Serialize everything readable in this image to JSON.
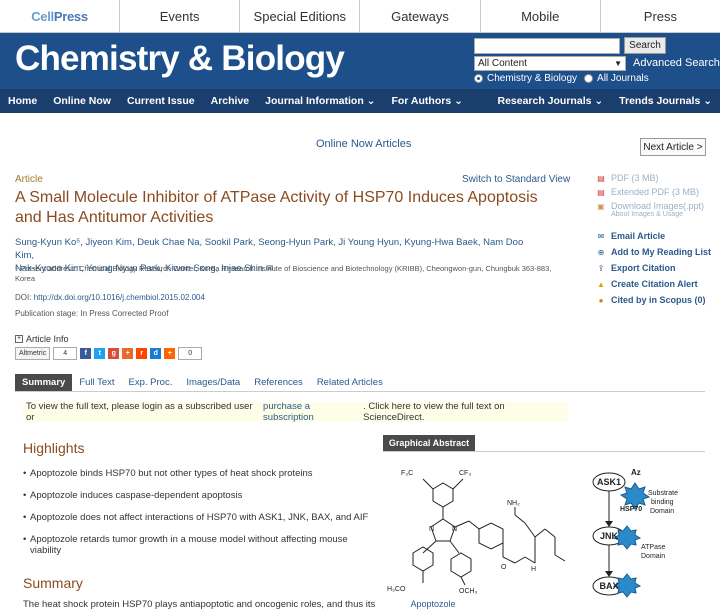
{
  "brand": {
    "logo_a": "Cell",
    "logo_b": "Press"
  },
  "topnav": [
    "Events",
    "Special Editions",
    "Gateways",
    "Mobile",
    "Press"
  ],
  "banner": {
    "title": "Chemistry & Biology",
    "search_button": "Search",
    "search_scope": "All Content",
    "advanced_search": "Advanced Search",
    "radio_journal": "Chemistry & Biology",
    "radio_all": "All Journals"
  },
  "mainnav": {
    "left": [
      "Home",
      "Online Now",
      "Current Issue",
      "Archive",
      "Journal Information ⌄",
      "For Authors ⌄"
    ],
    "right": [
      "Research Journals ⌄",
      "Trends Journals ⌄"
    ]
  },
  "page": {
    "online_now": "Online Now Articles",
    "next_article": "Next Article >",
    "article_label": "Article",
    "switch_view": "Switch to Standard View",
    "title": "A Small Molecule Inhibitor of ATPase Activity of HSP70 Induces Apoptosis and Has Antitumor Activities",
    "authors_1": "Sung-Kyun Ko⁵, Jiyeon Kim, Deuk Chae Na, Sookil Park, Seong-Hyun Park, Ji Young Hyun, Kyung-Hwa Baek, Nam Doo Kim,",
    "authors_2": "Nak-Kyoon Kim, Young Nyun Park, Kiwon Song, Injae Shin",
    "present_address": "⁵ Present address: Chemical Biology Research Center, Korea Research Institute of Bioscience and Biotechnology (KRIBB), Cheongwon-gun, Chungbuk 363-883, Korea",
    "doi_label": "DOI:",
    "doi": "http://dx.doi.org/10.1016/j.chembiol.2015.02.004",
    "pub_stage": "Publication stage: In Press Corrected Proof",
    "article_info": "Article Info",
    "altmetric": "Altmetric",
    "altmetric_count": "4",
    "share_count": "0"
  },
  "sidebar": {
    "pdf": "PDF (3 MB)",
    "ext_pdf": "Extended PDF (3 MB)",
    "download_images": "Download Images(.ppt)",
    "about_images": "About Images & Usage",
    "email": "Email Article",
    "reading_list": "Add to My Reading List",
    "export": "Export Citation",
    "alert": "Create Citation Alert",
    "scopus": "Cited by in Scopus (0)"
  },
  "tabs": [
    "Summary",
    "Full Text",
    "Exp. Proc.",
    "Images/Data",
    "References",
    "Related Articles"
  ],
  "notice": {
    "a": "To view the full text, please login as a subscribed user or ",
    "b": "purchase a subscription",
    "c": ". Click here to view the full text on ScienceDirect."
  },
  "highlights": {
    "heading": "Highlights",
    "items": [
      "Apoptozole binds HSP70 but not other types of heat shock proteins",
      "Apoptozole induces caspase-dependent apoptosis",
      "Apoptozole does not affect interactions of HSP70 with ASK1, JNK, BAX, and AIF",
      "Apoptozole retards tumor growth in a mouse model without affecting mouse viability"
    ]
  },
  "summary": {
    "heading": "Summary",
    "text": "The heat shock protein HSP70 plays antiapoptotic and oncogenic roles, and thus its"
  },
  "graphical_abstract": {
    "tab": "Graphical Abstract",
    "compound": "Apoptozole",
    "cf3": "CF₃",
    "f3c": "F₃C",
    "nh2": "NH₂",
    "och3": "OCH₃",
    "h3co": "H₃CO",
    "n": "N",
    "h": "H",
    "o": "O",
    "az": "Az",
    "ask1": "ASK1",
    "jnk": "JNK",
    "bax": "BAX",
    "hsp70": "HSP70",
    "sub1": "Substrate",
    "sub2": "binding",
    "sub3": "Domain",
    "atp1": "ATPase",
    "atp2": "Domain"
  },
  "colors": {
    "banner": "#1d4f8b",
    "nav": "#1a3f6e",
    "title": "#8a4b1e",
    "link": "#2a5a8c"
  }
}
